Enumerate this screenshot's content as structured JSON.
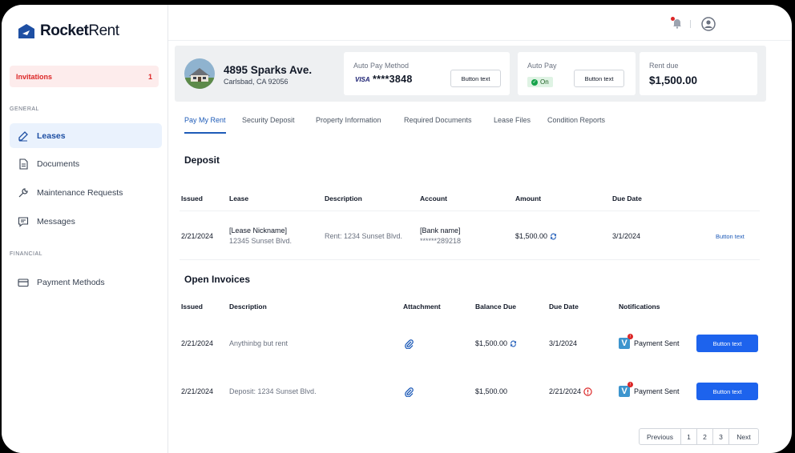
{
  "app": {
    "brand_bold": "Rocket",
    "brand_light": "Rent"
  },
  "sidebar": {
    "invitations": {
      "label": "Invitations",
      "count": "1"
    },
    "general_label": "GENERAL",
    "financial_label": "FINANCIAL",
    "items": [
      {
        "label": "Leases",
        "icon": "edit-icon"
      },
      {
        "label": "Documents",
        "icon": "document-icon"
      },
      {
        "label": "Maintenance Requests",
        "icon": "wrench-icon"
      },
      {
        "label": "Messages",
        "icon": "message-icon"
      },
      {
        "label": "Payment Methods",
        "icon": "card-icon"
      }
    ]
  },
  "property": {
    "address": "4895 Sparks Ave.",
    "city": "Carlsbad, CA 92056",
    "autopay_method": {
      "label": "Auto Pay Method",
      "brand": "VISA",
      "masked": "****3848",
      "button": "Button text"
    },
    "autopay": {
      "label": "Auto Pay",
      "status": "On",
      "button": "Button text"
    },
    "rent_due": {
      "label": "Rent due",
      "amount": "$1,500.00"
    }
  },
  "tabs": [
    "Pay My Rent",
    "Security Deposit",
    "Property Information",
    "Required Documents",
    "Lease Files",
    "Condition Reports"
  ],
  "deposit": {
    "title": "Deposit",
    "headers": [
      "Issued",
      "Lease",
      "Description",
      "Account",
      "Amount",
      "Due Date"
    ],
    "row": {
      "issued": "2/21/2024",
      "lease_name": "[Lease Nickname]",
      "lease_addr": "12345 Sunset Blvd.",
      "description": "Rent: 1234 Sunset Blvd.",
      "account_name": "[Bank name]",
      "account_masked": "******289218",
      "amount": "$1,500.00",
      "due": "3/1/2024",
      "button": "Button text"
    }
  },
  "invoices": {
    "title": "Open Invoices",
    "headers": [
      "Issued",
      "Description",
      "Attachment",
      "Balance Due",
      "Due Date",
      "Notifications"
    ],
    "rows": [
      {
        "issued": "2/21/2024",
        "description": "Anythinbg but rent",
        "balance": "$1,500.00",
        "due": "3/1/2024",
        "notification": "Payment Sent",
        "button": "Button text"
      },
      {
        "issued": "2/21/2024",
        "description": "Deposit: 1234 Sunset Blvd.",
        "balance": "$1,500.00",
        "due": "2/21/2024",
        "notification": "Payment Sent",
        "button": "Button text"
      }
    ]
  },
  "pagination": {
    "previous": "Previous",
    "pages": [
      "1",
      "2",
      "3"
    ],
    "next": "Next"
  },
  "colors": {
    "accent": "#1d63ed",
    "danger": "#dc2626",
    "active_bg": "#eaf2fd"
  }
}
